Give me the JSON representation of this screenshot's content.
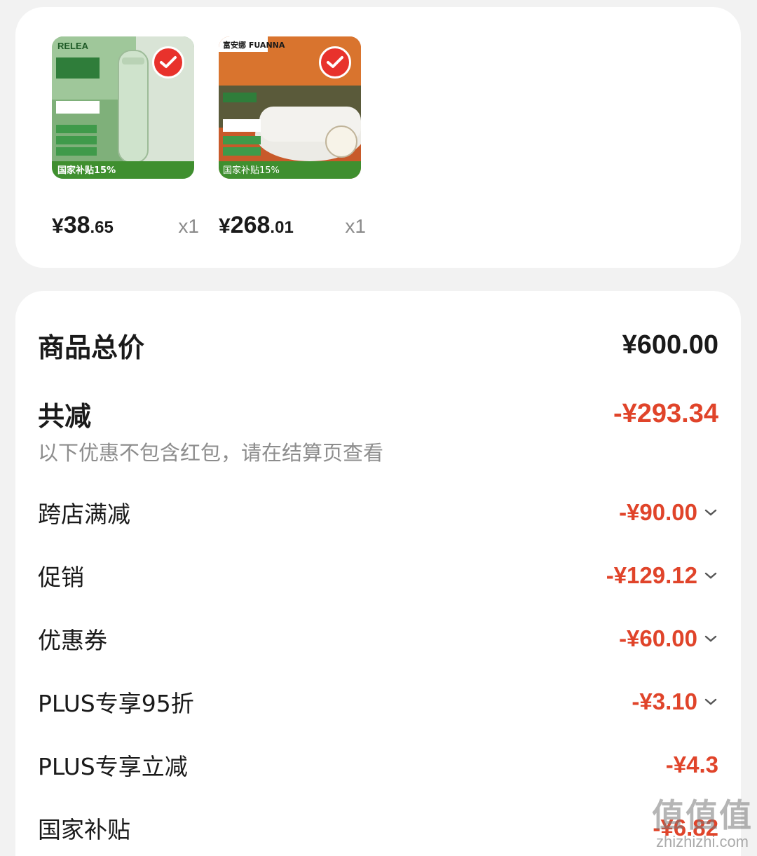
{
  "products": [
    {
      "image": "green-thermos-bottle",
      "brand_text": "RELEA",
      "promo_text": "国家补贴15%",
      "price_currency": "¥",
      "price_int": "38",
      "price_dec": ".65",
      "qty": "x1"
    },
    {
      "image": "white-wool-quilt",
      "brand_text": "富安娜 FUANNA",
      "promo_text": "国家补贴15%",
      "price_currency": "¥",
      "price_int": "268",
      "price_dec": ".01",
      "qty": "x1"
    }
  ],
  "summary": {
    "total_label": "商品总价",
    "total_value": "¥600.00",
    "discount_label": "共减",
    "discount_value": "-¥293.34",
    "note": "以下优惠不包含红包，请在结算页查看",
    "items": [
      {
        "label": "跨店满减",
        "value": "-¥90.00",
        "expandable": true
      },
      {
        "label": "促销",
        "value": "-¥129.12",
        "expandable": true
      },
      {
        "label": "优惠券",
        "value": "-¥60.00",
        "expandable": true
      },
      {
        "label": "PLUS专享95折",
        "value": "-¥3.10",
        "expandable": true
      },
      {
        "label": "PLUS专享立减",
        "value": "-¥4.3",
        "expandable": false
      },
      {
        "label": "国家补贴",
        "value": "-¥6.82",
        "expandable": false
      }
    ]
  },
  "watermark": {
    "big": "值值值",
    "small": "zhizhizhi.com"
  },
  "colors": {
    "accent_red": "#e0442a",
    "check_red": "#e8322c",
    "background": "#f2f2f2"
  }
}
